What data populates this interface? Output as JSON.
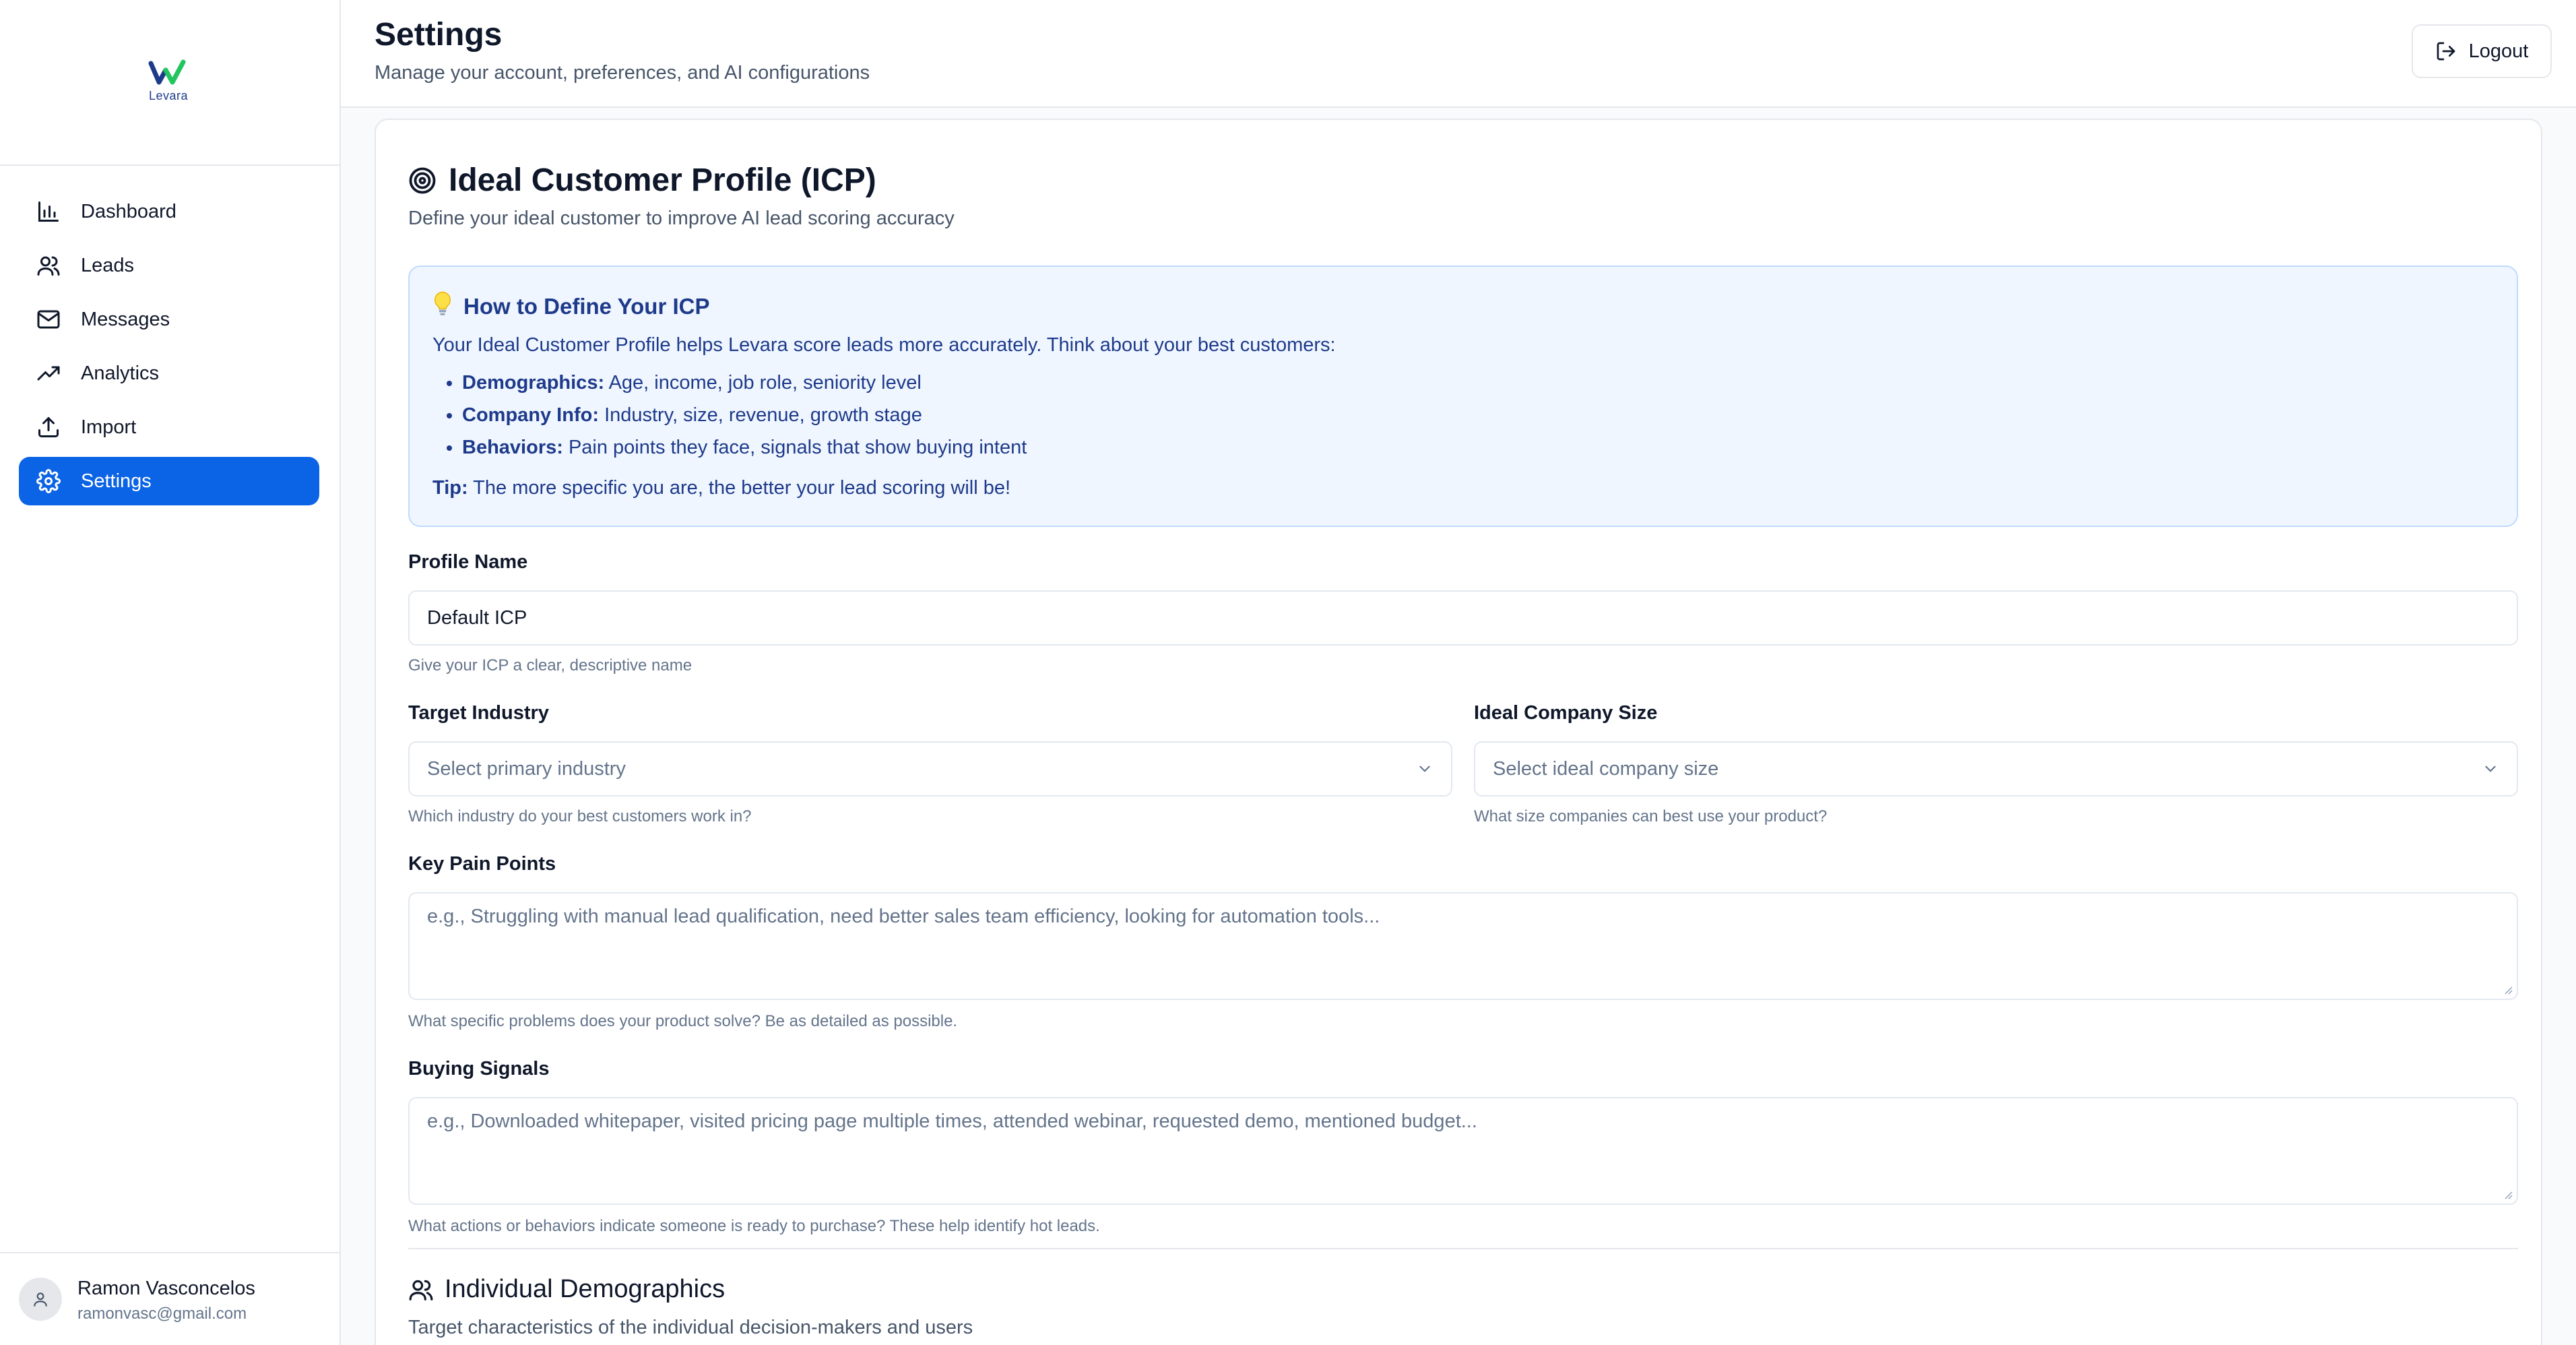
{
  "brand": {
    "name": "Levara"
  },
  "sidebar": {
    "items": [
      {
        "label": "Dashboard",
        "icon": "bar-chart-icon",
        "active": false
      },
      {
        "label": "Leads",
        "icon": "users-icon",
        "active": false
      },
      {
        "label": "Messages",
        "icon": "mail-icon",
        "active": false
      },
      {
        "label": "Analytics",
        "icon": "trending-up-icon",
        "active": false
      },
      {
        "label": "Import",
        "icon": "upload-icon",
        "active": false
      },
      {
        "label": "Settings",
        "icon": "gear-icon",
        "active": true
      }
    ],
    "user": {
      "name": "Ramon Vasconcelos",
      "email": "ramonvasc@gmail.com"
    }
  },
  "header": {
    "title": "Settings",
    "subtitle": "Manage your account, preferences, and AI configurations",
    "logout_label": "Logout"
  },
  "icp": {
    "title": "Ideal Customer Profile (ICP)",
    "subtitle": "Define your ideal customer to improve AI lead scoring accuracy",
    "info": {
      "title": "How to Define Your ICP",
      "intro": "Your Ideal Customer Profile helps Levara score leads more accurately. Think about your best customers:",
      "items": [
        {
          "term": "Demographics:",
          "text": "Age, income, job role, seniority level"
        },
        {
          "term": "Company Info:",
          "text": "Industry, size, revenue, growth stage"
        },
        {
          "term": "Behaviors:",
          "text": "Pain points they face, signals that show buying intent"
        }
      ],
      "tip_term": "Tip:",
      "tip_text": "The more specific you are, the better your lead scoring will be!"
    },
    "profile_name": {
      "label": "Profile Name",
      "value": "Default ICP",
      "hint": "Give your ICP a clear, descriptive name"
    },
    "target_industry": {
      "label": "Target Industry",
      "placeholder": "Select primary industry",
      "hint": "Which industry do your best customers work in?"
    },
    "company_size": {
      "label": "Ideal Company Size",
      "placeholder": "Select ideal company size",
      "hint": "What size companies can best use your product?"
    },
    "pain_points": {
      "label": "Key Pain Points",
      "placeholder": "e.g., Struggling with manual lead qualification, need better sales team efficiency, looking for automation tools...",
      "hint": "What specific problems does your product solve? Be as detailed as possible."
    },
    "buying_signals": {
      "label": "Buying Signals",
      "placeholder": "e.g., Downloaded whitepaper, visited pricing page multiple times, attended webinar, requested demo, mentioned budget...",
      "hint": "What actions or behaviors indicate someone is ready to purchase? These help identify hot leads."
    },
    "demographics": {
      "title": "Individual Demographics",
      "subtitle": "Target characteristics of the individual decision-makers and users"
    }
  },
  "colors": {
    "accent": "#0b63e5",
    "info_bg": "#eff6ff",
    "info_text": "#1e3a8a"
  }
}
